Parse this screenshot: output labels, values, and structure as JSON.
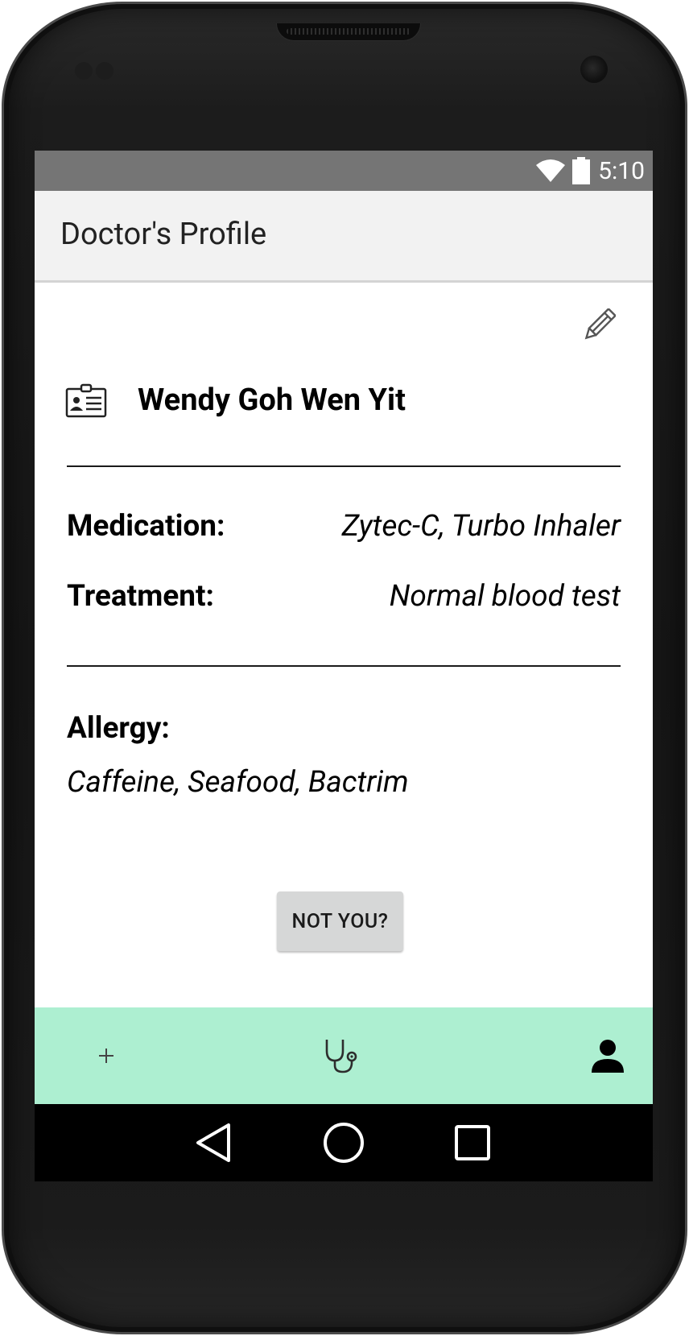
{
  "status_bar": {
    "time": "5:10",
    "icons": [
      "wifi-icon",
      "battery-icon"
    ]
  },
  "app_bar": {
    "title": "Doctor's Profile"
  },
  "profile": {
    "edit_icon": "pencil-icon",
    "id_icon": "id-card-icon",
    "name": "Wendy Goh Wen Yit",
    "medication_label": "Medication:",
    "medication_value": "Zytec-C, Turbo Inhaler",
    "treatment_label": "Treatment:",
    "treatment_value": "Normal blood test",
    "allergy_label": "Allergy:",
    "allergy_value": "Caffeine, Seafood, Bactrim",
    "not_you_label": "NOT YOU?"
  },
  "bottom_nav": {
    "items": [
      {
        "icon": "plus-icon"
      },
      {
        "icon": "stethoscope-icon"
      },
      {
        "icon": "person-icon"
      }
    ],
    "background": "#adefd1"
  },
  "system_nav": {
    "buttons": [
      "back-icon",
      "home-icon",
      "recents-icon"
    ]
  }
}
